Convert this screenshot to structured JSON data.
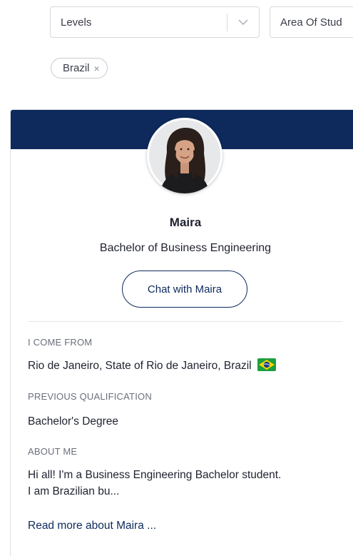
{
  "filters": {
    "levels": {
      "label": "Levels"
    },
    "area_of_study": {
      "label": "Area Of Stud"
    }
  },
  "chips": [
    {
      "label": "Brazil",
      "remove_symbol": "×"
    }
  ],
  "profile": {
    "name": "Maira",
    "degree": "Bachelor of Business Engineering",
    "chat_button": "Chat with Maira",
    "sections": {
      "come_from": {
        "label": "I COME FROM",
        "value": "Rio de Janeiro, State of Rio de Janeiro, Brazil",
        "flag_icon": "brazil-flag-icon"
      },
      "qualification": {
        "label": "PREVIOUS QUALIFICATION",
        "value": "Bachelor's Degree"
      },
      "about": {
        "label": "ABOUT ME",
        "value_line1": "Hi all! I'm a Business Engineering Bachelor student.",
        "value_line2": "I am Brazilian bu..."
      }
    },
    "read_more": "Read more about Maira ..."
  },
  "colors": {
    "banner": "#0e2a5c",
    "accent": "#0e2a5c",
    "muted_text": "#6b6f7b"
  }
}
